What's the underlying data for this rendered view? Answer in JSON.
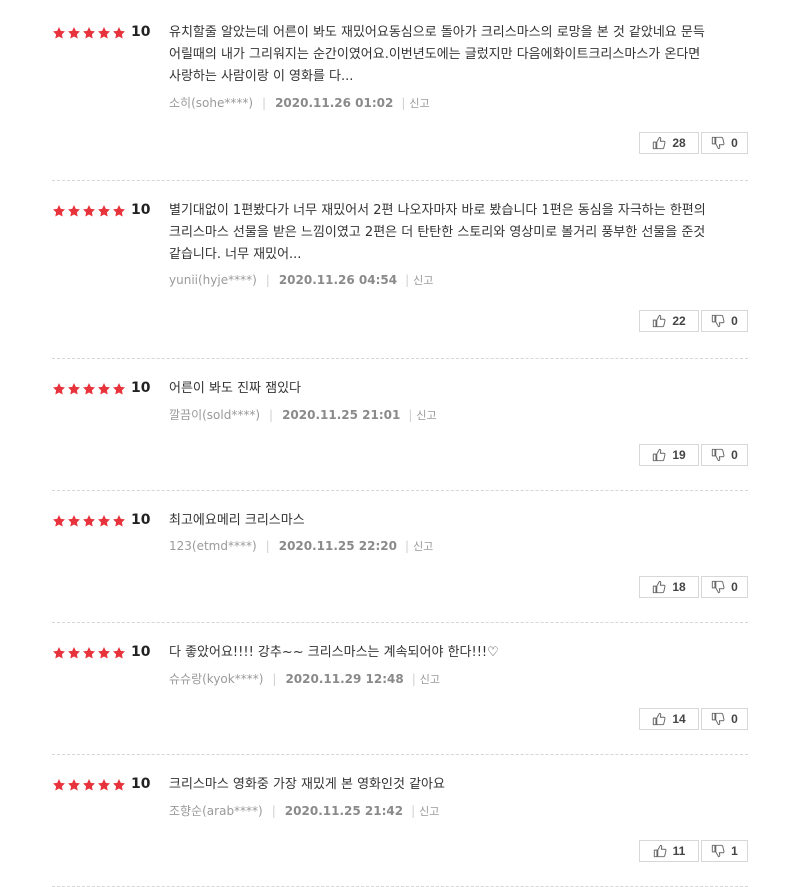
{
  "reviews": [
    {
      "rating": 10,
      "stars": 5,
      "text": "유치할줄 알았는데 어른이 봐도 재밌어요동심으로 돌아가 크리스마스의 로망을 본 것 같았네요 문득 어릴때의 내가 그리워지는 순간이였어요.이번년도에는 글렀지만 다음에화이트크리스마스가 온다면 사랑하는 사람이랑 이 영화를 다...",
      "author": "소히(sohe****)",
      "date": "2020.11.26 01:02",
      "report": "신고",
      "likes": "28",
      "dislikes": "0"
    },
    {
      "rating": 10,
      "stars": 5,
      "text": "별기대없이 1편봤다가 너무 재밌어서 2편 나오자마자 바로 봤습니다 1편은 동심을 자극하는 한편의 크리스마스 선물을 받은 느낌이였고 2편은 더 탄탄한 스토리와 영상미로 볼거리 풍부한 선물을 준것 같습니다. 너무 재밌어...",
      "author": "yunii(hyje****)",
      "date": "2020.11.26 04:54",
      "report": "신고",
      "likes": "22",
      "dislikes": "0"
    },
    {
      "rating": 10,
      "stars": 5,
      "text": "어른이 봐도 진짜 잼있다",
      "author": "깔끔이(sold****)",
      "date": "2020.11.25 21:01",
      "report": "신고",
      "likes": "19",
      "dislikes": "0"
    },
    {
      "rating": 10,
      "stars": 5,
      "text": "최고에요메리 크리스마스",
      "author": "123(etmd****)",
      "date": "2020.11.25 22:20",
      "report": "신고",
      "likes": "18",
      "dislikes": "0"
    },
    {
      "rating": 10,
      "stars": 5,
      "text": "다 좋았어요!!!! 강추~~ 크리스마스는 계속되어야 한다!!!♡",
      "author": "슈슈랑(kyok****)",
      "date": "2020.11.29 12:48",
      "report": "신고",
      "likes": "14",
      "dislikes": "0"
    },
    {
      "rating": 10,
      "stars": 5,
      "text": "크리스마스 영화중 가장 재밌게 본 영화인것 같아요",
      "author": "조향순(arab****)",
      "date": "2020.11.25 21:42",
      "report": "신고",
      "likes": "11",
      "dislikes": "1"
    }
  ],
  "colors": {
    "star": "#e8323c",
    "text": "#333333",
    "meta": "#9a9a9a",
    "border": "#d7d7d7"
  },
  "icons": {
    "star": "star-icon",
    "like": "thumbs-up-icon",
    "dislike": "thumbs-down-icon"
  }
}
